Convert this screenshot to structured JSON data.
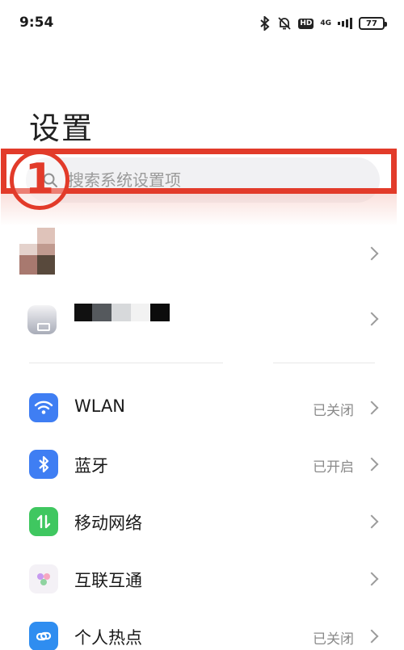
{
  "status_bar": {
    "time": "9:54",
    "hd_label": "HD",
    "network_label": "4G",
    "battery_level": "77"
  },
  "page": {
    "title": "设置"
  },
  "search": {
    "placeholder": "搜索系统设置项"
  },
  "annotation": {
    "step_number": "1",
    "color": "#e23b2a"
  },
  "settings_list": [
    {
      "label": "WLAN",
      "status": "已关闭",
      "icon": "wifi-icon",
      "icon_color": "#3f7ef3"
    },
    {
      "label": "蓝牙",
      "status": "已开启",
      "icon": "bluetooth-icon",
      "icon_color": "#3f7ef3"
    },
    {
      "label": "移动网络",
      "status": "",
      "icon": "mobile-data-icon",
      "icon_color": "#3fc760"
    },
    {
      "label": "互联互通",
      "status": "",
      "icon": "connect-icon",
      "icon_color": "#f4f1f6"
    },
    {
      "label": "个人热点",
      "status": "已关闭",
      "icon": "hotspot-icon",
      "icon_color": "#2f8df0"
    }
  ]
}
